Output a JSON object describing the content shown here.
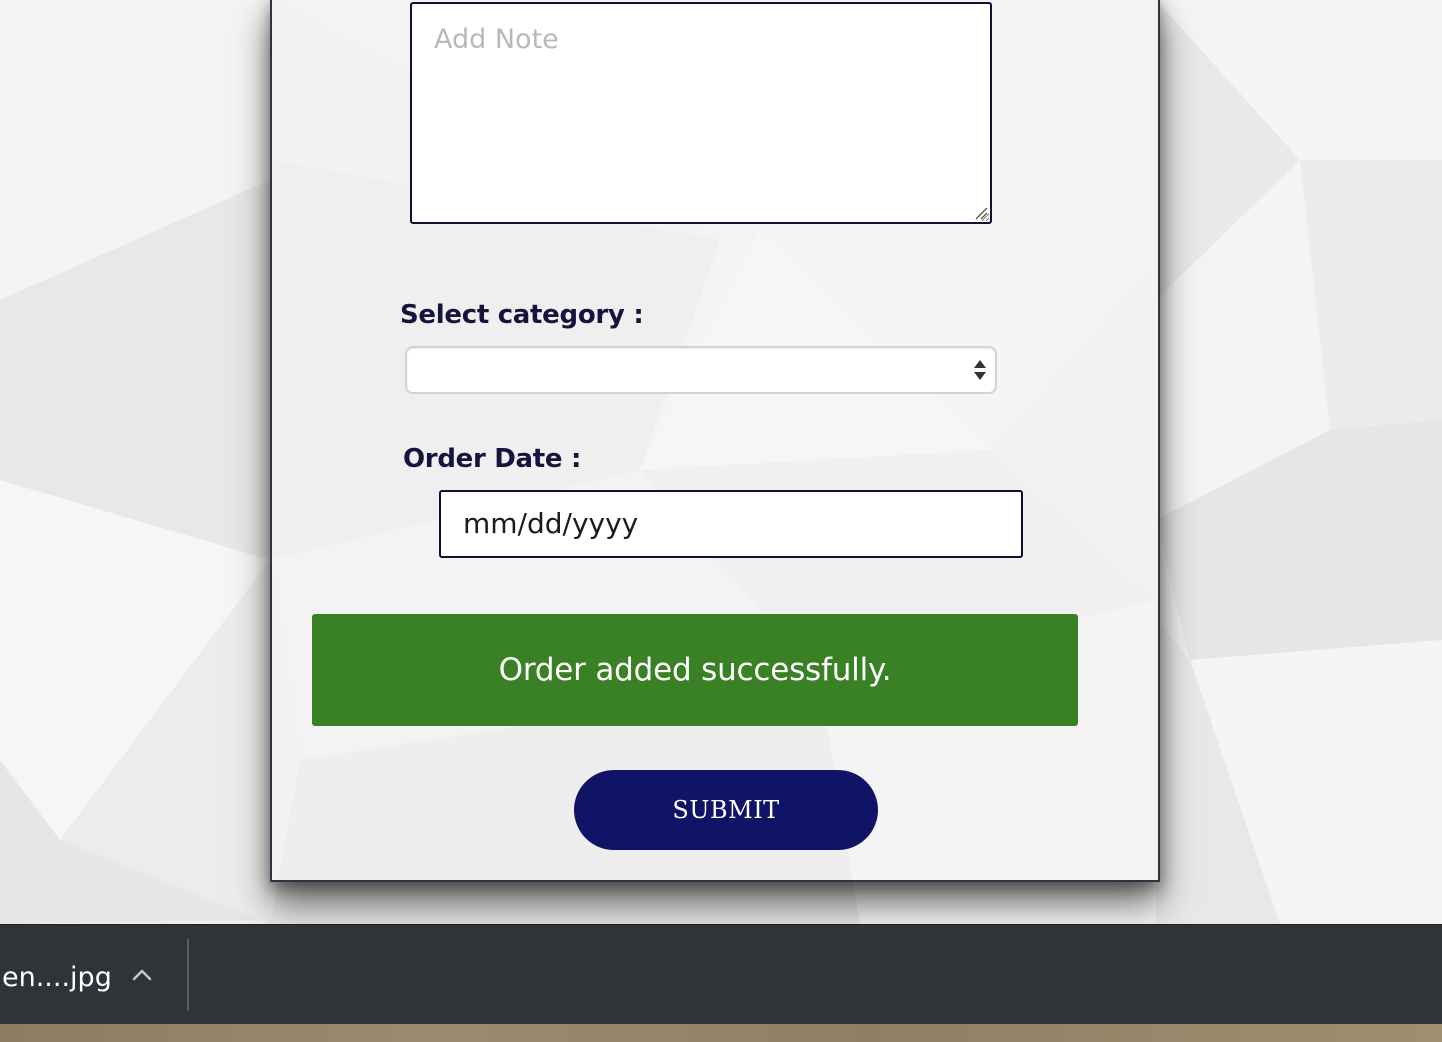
{
  "form": {
    "note_placeholder": "Add Note",
    "note_value": "",
    "category_label": "Select category :",
    "category_value": "",
    "order_date_label": "Order Date :",
    "order_date_value": "mm/dd/yyyy",
    "success_message": "Order added successfully.",
    "submit_label": "SUBMIT"
  },
  "download_bar": {
    "file_name": "en....jpg",
    "chevron_icon": "chevron-up-icon"
  },
  "colors": {
    "success": "#3a8024",
    "submit": "#0f1466",
    "label_text": "#14143c",
    "download_bar": "#303338"
  }
}
